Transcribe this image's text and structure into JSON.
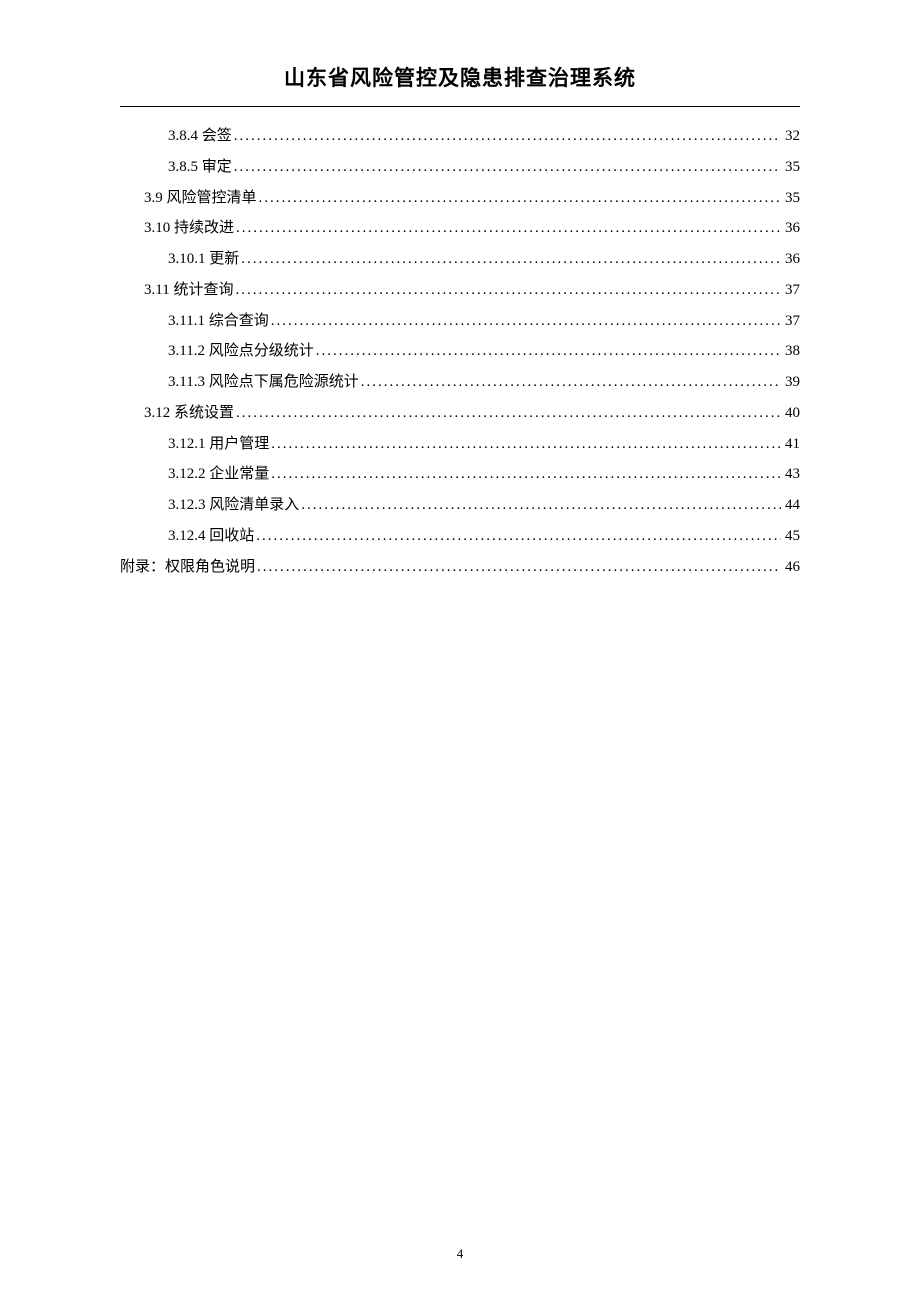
{
  "header": {
    "title": "山东省风险管控及隐患排查治理系统"
  },
  "toc": {
    "entries": [
      {
        "level": 2,
        "label": "3.8.4 会签",
        "page": "32"
      },
      {
        "level": 2,
        "label": "3.8.5 审定",
        "page": "35"
      },
      {
        "level": 1,
        "label": "3.9 风险管控清单",
        "page": "35"
      },
      {
        "level": 1,
        "label": "3.10 持续改进",
        "page": "36"
      },
      {
        "level": 2,
        "label": "3.10.1 更新",
        "page": "36"
      },
      {
        "level": 1,
        "label": "3.11 统计查询",
        "page": "37"
      },
      {
        "level": 2,
        "label": "3.11.1 综合查询",
        "page": "37"
      },
      {
        "level": 2,
        "label": "3.11.2 风险点分级统计",
        "page": "38"
      },
      {
        "level": 2,
        "label": "3.11.3 风险点下属危险源统计",
        "page": "39"
      },
      {
        "level": 1,
        "label": "3.12 系统设置",
        "page": "40"
      },
      {
        "level": 2,
        "label": "3.12.1 用户管理",
        "page": "41"
      },
      {
        "level": 2,
        "label": "3.12.2 企业常量",
        "page": "43"
      },
      {
        "level": 2,
        "label": "3.12.3 风险清单录入",
        "page": "44"
      },
      {
        "level": 2,
        "label": "3.12.4 回收站",
        "page": "45"
      },
      {
        "level": 0,
        "label": "附录：权限角色说明",
        "page": "46"
      }
    ]
  },
  "footer": {
    "page_number": "4"
  }
}
